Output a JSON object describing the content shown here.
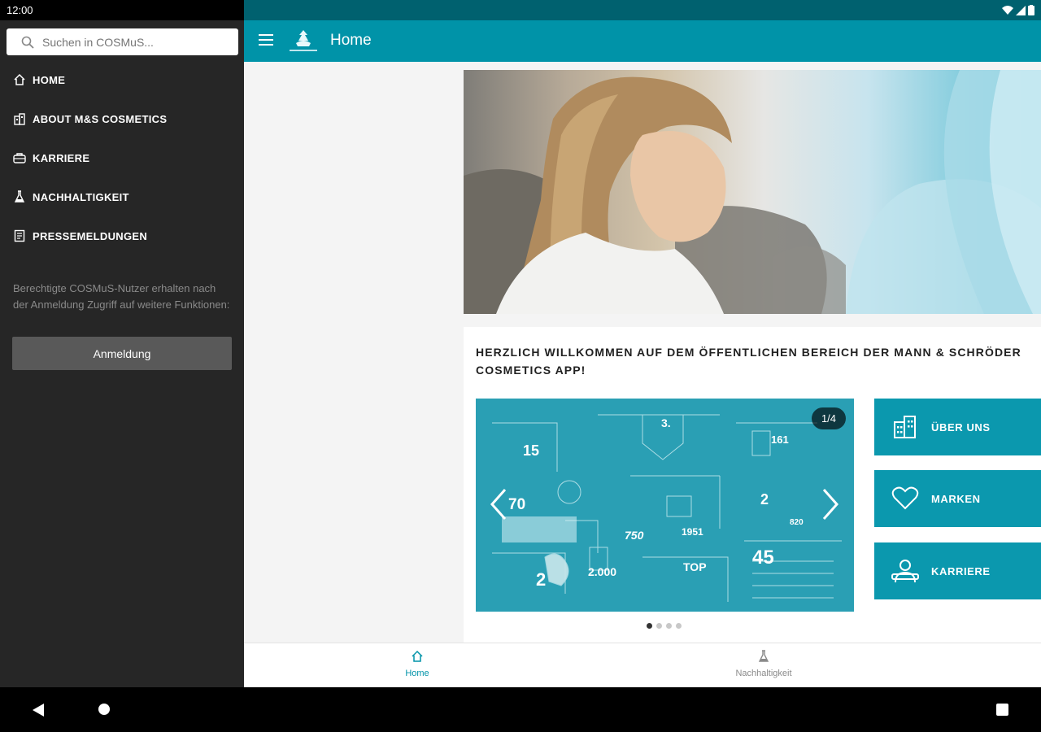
{
  "status_bar": {
    "time": "12:00"
  },
  "drawer": {
    "search_placeholder": "Suchen in COSMuS...",
    "items": [
      {
        "label": "HOME",
        "icon": "home-icon"
      },
      {
        "label": "ABOUT M&S COSMETICS",
        "icon": "building-icon"
      },
      {
        "label": "KARRIERE",
        "icon": "career-icon"
      },
      {
        "label": "NACHHALTIGKEIT",
        "icon": "flask-icon"
      },
      {
        "label": "PRESSEMELDUNGEN",
        "icon": "document-icon"
      }
    ],
    "note": "Berechtigte COSMuS-Nutzer erhalten nach der Anmeldung Zugriff auf weitere Funktionen:",
    "login_label": "Anmeldung"
  },
  "appbar": {
    "title": "Home"
  },
  "main": {
    "welcome": "HERZLICH WILLKOMMEN AUF DEM ÖFFENTLICHEN BEREICH DER MANN & SCHRÖDER COSMETICS APP!",
    "carousel": {
      "counter": "1/4",
      "infographic_texts": [
        "15",
        "70",
        "3.",
        "161",
        "2",
        "750",
        "1951",
        "TOP",
        "45",
        "2.000",
        "820",
        "2"
      ]
    },
    "tiles": [
      {
        "label": "ÜBER UNS",
        "icon": "building-icon"
      },
      {
        "label": "MARKEN",
        "icon": "heart-icon"
      },
      {
        "label": "KARRIERE",
        "icon": "career-icon"
      }
    ]
  },
  "tabbar": {
    "tabs": [
      {
        "label": "Home",
        "active": true
      },
      {
        "label": "Nachhaltigkeit",
        "active": false
      }
    ]
  },
  "colors": {
    "accent": "#0093a8",
    "tile": "#0b98ae",
    "drawer": "#262626",
    "status": "#00616f"
  }
}
